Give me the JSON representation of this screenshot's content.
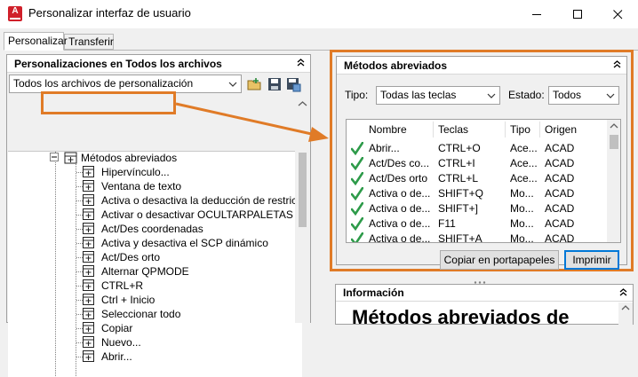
{
  "window": {
    "title": "Personalizar interfaz de usuario",
    "app_icon_letter": "A"
  },
  "tabs": [
    {
      "label": "Personalizar",
      "active": true
    },
    {
      "label": "Transferir",
      "active": false
    }
  ],
  "left_panel": {
    "header": "Personalizaciones en Todos los archivos",
    "file_combo_value": "Todos los archivos de personalización",
    "selected_node": "Métodos abreviados",
    "tree_items": [
      "Hipervínculo...",
      "Ventana de texto",
      "Activa o desactiva la deducción de restricciones",
      "Activar o desactivar OCULTARPALETAS",
      "Act/Des coordenadas",
      "Activa y desactiva el SCP dinámico",
      "Act/Des orto",
      "Alternar QPMODE",
      "CTRL+R",
      "Ctrl + Inicio",
      "Seleccionar todo",
      "Copiar",
      "Nuevo...",
      "Abrir..."
    ]
  },
  "shortcuts_panel": {
    "header": "Métodos abreviados",
    "type_label": "Tipo:",
    "type_value": "Todas las teclas",
    "state_label": "Estado:",
    "state_value": "Todos",
    "columns": [
      "Nombre",
      "Teclas",
      "Tipo",
      "Origen"
    ],
    "rows": [
      {
        "name": "Abrir...",
        "keys": "CTRL+O",
        "type": "Ace...",
        "origin": "ACAD"
      },
      {
        "name": "Act/Des co...",
        "keys": "CTRL+I",
        "type": "Ace...",
        "origin": "ACAD"
      },
      {
        "name": "Act/Des orto",
        "keys": "CTRL+L",
        "type": "Ace...",
        "origin": "ACAD"
      },
      {
        "name": "Activa o de...",
        "keys": "SHIFT+Q",
        "type": "Mo...",
        "origin": "ACAD"
      },
      {
        "name": "Activa o de...",
        "keys": "SHIFT+]",
        "type": "Mo...",
        "origin": "ACAD"
      },
      {
        "name": "Activa o de...",
        "keys": "F11",
        "type": "Mo...",
        "origin": "ACAD"
      },
      {
        "name": "Activa o de...",
        "keys": "SHIFT+A",
        "type": "Mo...",
        "origin": "ACAD"
      }
    ],
    "copy_button": "Copiar en portapapeles",
    "print_button": "Imprimir"
  },
  "info_panel": {
    "header": "Información",
    "title": "Métodos abreviados de"
  },
  "colors": {
    "highlight": "#e07b27",
    "check": "#2e9b4a"
  }
}
